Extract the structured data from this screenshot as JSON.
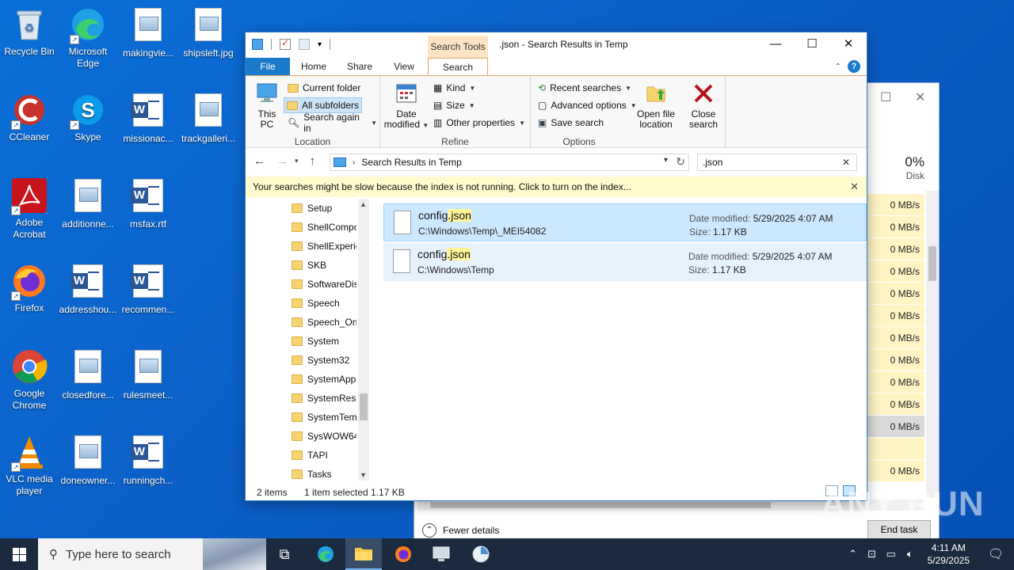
{
  "desktop": {
    "icons": [
      {
        "label": "Recycle Bin"
      },
      {
        "label": "Microsoft Edge"
      },
      {
        "label": "makingvie..."
      },
      {
        "label": "shipsleft.jpg"
      },
      {
        "label": "CCleaner"
      },
      {
        "label": "Skype"
      },
      {
        "label": "missionac..."
      },
      {
        "label": "trackgalleri..."
      },
      {
        "label": "Adobe Acrobat"
      },
      {
        "label": "additionne..."
      },
      {
        "label": "msfax.rtf"
      },
      {
        "label": "Firefox"
      },
      {
        "label": "addresshou..."
      },
      {
        "label": "recommen..."
      },
      {
        "label": "Google Chrome"
      },
      {
        "label": "closedfore..."
      },
      {
        "label": "rulesmeet..."
      },
      {
        "label": "VLC media player"
      },
      {
        "label": "doneowner..."
      },
      {
        "label": "runningch..."
      }
    ]
  },
  "explorer": {
    "title": ".json - Search Results in Temp",
    "context_tab": "Search Tools",
    "tabs": {
      "file": "File",
      "home": "Home",
      "share": "Share",
      "view": "View",
      "search": "Search"
    },
    "ribbon": {
      "location": {
        "this_pc": "This PC",
        "current_folder": "Current folder",
        "all_subfolders": "All subfolders",
        "search_again_in": "Search again in",
        "group_label": "Location"
      },
      "refine": {
        "date_modified": "Date modified",
        "kind": "Kind",
        "size": "Size",
        "other_properties": "Other properties",
        "group_label": "Refine"
      },
      "options": {
        "recent_searches": "Recent searches",
        "advanced_options": "Advanced options",
        "save_search": "Save search",
        "open_file_location": "Open file location",
        "close_search": "Close search",
        "group_label": "Options"
      }
    },
    "address": {
      "path": "Search Results in Temp"
    },
    "search": {
      "query": ".json"
    },
    "infobar": "Your searches might be slow because the index is not running.  Click to turn on the index...",
    "tree": [
      "Setup",
      "ShellCompo",
      "ShellExperie",
      "SKB",
      "SoftwareDis",
      "Speech",
      "Speech_One",
      "System",
      "System32",
      "SystemApps",
      "SystemReso",
      "SystemTemp",
      "SysWOW64",
      "TAPI",
      "Tasks"
    ],
    "results": [
      {
        "name_prefix": "config",
        "name_match": ".json",
        "path": "C:\\Windows\\Temp\\_MEI54082",
        "date_label": "Date modified:",
        "date": "5/29/2025 4:07 AM",
        "size_label": "Size:",
        "size": "1.17 KB",
        "selected": true
      },
      {
        "name_prefix": "config",
        "name_match": ".json",
        "path": "C:\\Windows\\Temp",
        "date_label": "Date modified:",
        "date": "5/29/2025 4:07 AM",
        "size_label": "Size:",
        "size": "1.17 KB",
        "selected": false
      }
    ],
    "status": {
      "items": "2 items",
      "selected": "1 item selected  1.17 KB"
    }
  },
  "task_manager": {
    "disk_percent": "0%",
    "disk_label": "Disk",
    "rates": [
      "0 MB/s",
      "0 MB/s",
      "0 MB/s",
      "0 MB/s",
      "0 MB/s",
      "0 MB/s",
      "0 MB/s",
      "0 MB/s",
      "0 MB/s",
      "0 MB/s",
      "0 MB/s"
    ],
    "last_rate": "0 MB/s",
    "fewer_details": "Fewer details",
    "end_task": "End task"
  },
  "taskbar": {
    "search_placeholder": "Type here to search",
    "time": "4:11 AM",
    "date": "5/29/2025"
  },
  "watermark": "ANY RUN"
}
